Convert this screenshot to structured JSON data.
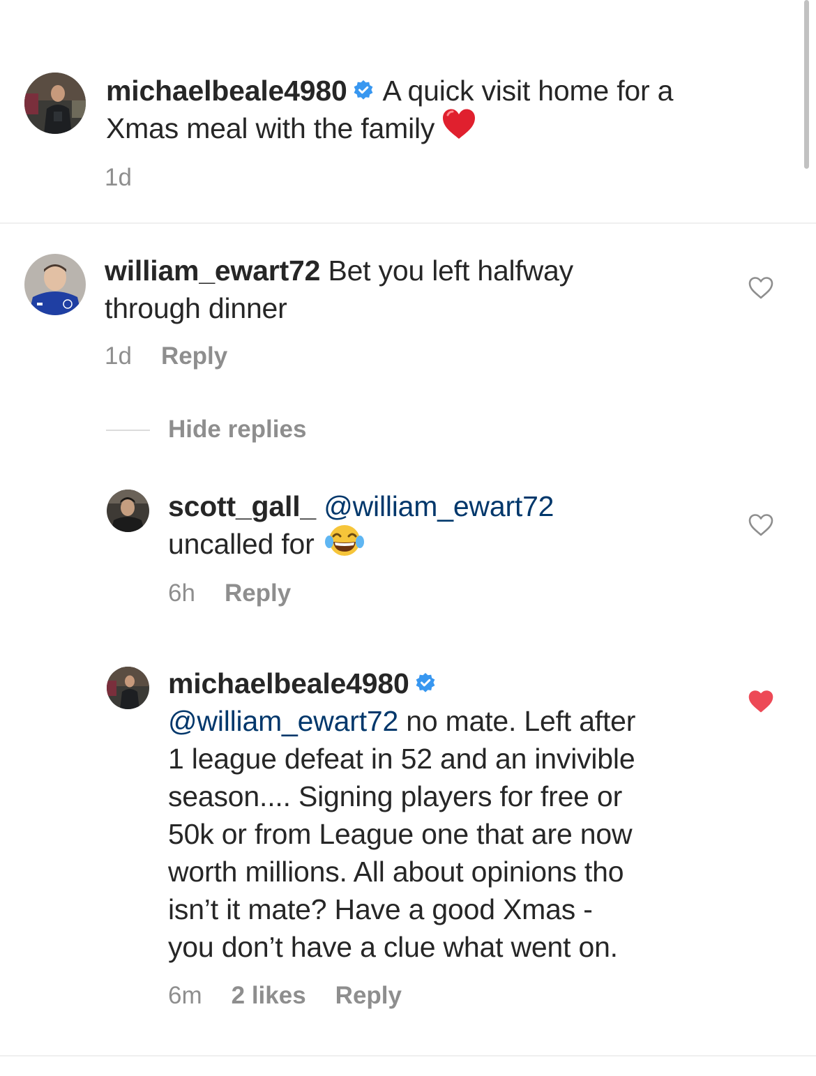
{
  "post": {
    "username": "michaelbeale4980",
    "verified": true,
    "caption": "A quick visit home for a",
    "caption_line2": "Xmas meal with the family",
    "emoji": "red-heart",
    "time": "1d"
  },
  "comments": [
    {
      "username": "william_ewart72",
      "text_line1": "Bet you left halfway",
      "text_line2": "through dinner",
      "time": "1d",
      "reply_label": "Reply",
      "liked": false
    }
  ],
  "replies_toggle": "Hide replies",
  "replies": [
    {
      "username": "scott_gall_",
      "mention": "@william_ewart72",
      "text_line2": "uncalled for",
      "emoji": "face-with-tears-of-joy",
      "time": "6h",
      "reply_label": "Reply",
      "liked": false
    },
    {
      "username": "michaelbeale4980",
      "verified": true,
      "mention": "@william_ewart72",
      "text_line1": " no mate. Left after",
      "text_line2": "1 league defeat in 52 and an invivible",
      "text_line3": "season.... Signing players for free or",
      "text_line4": "50k or from League one that are now",
      "text_line5": "worth millions. All about opinions tho",
      "text_line6": "isn’t it mate? Have a good Xmas -",
      "text_line7": "you don’t have a clue what went on.",
      "time": "6m",
      "likes": "2 likes",
      "reply_label": "Reply",
      "liked": true
    }
  ],
  "colors": {
    "text": "#262626",
    "secondary": "#8e8e8e",
    "mention": "#00376b",
    "verified": "#3897f0",
    "liked_heart": "#ed4956"
  },
  "icons": {
    "verified": "verified-badge-icon",
    "like": "heart-outline-icon",
    "liked": "heart-filled-icon"
  }
}
